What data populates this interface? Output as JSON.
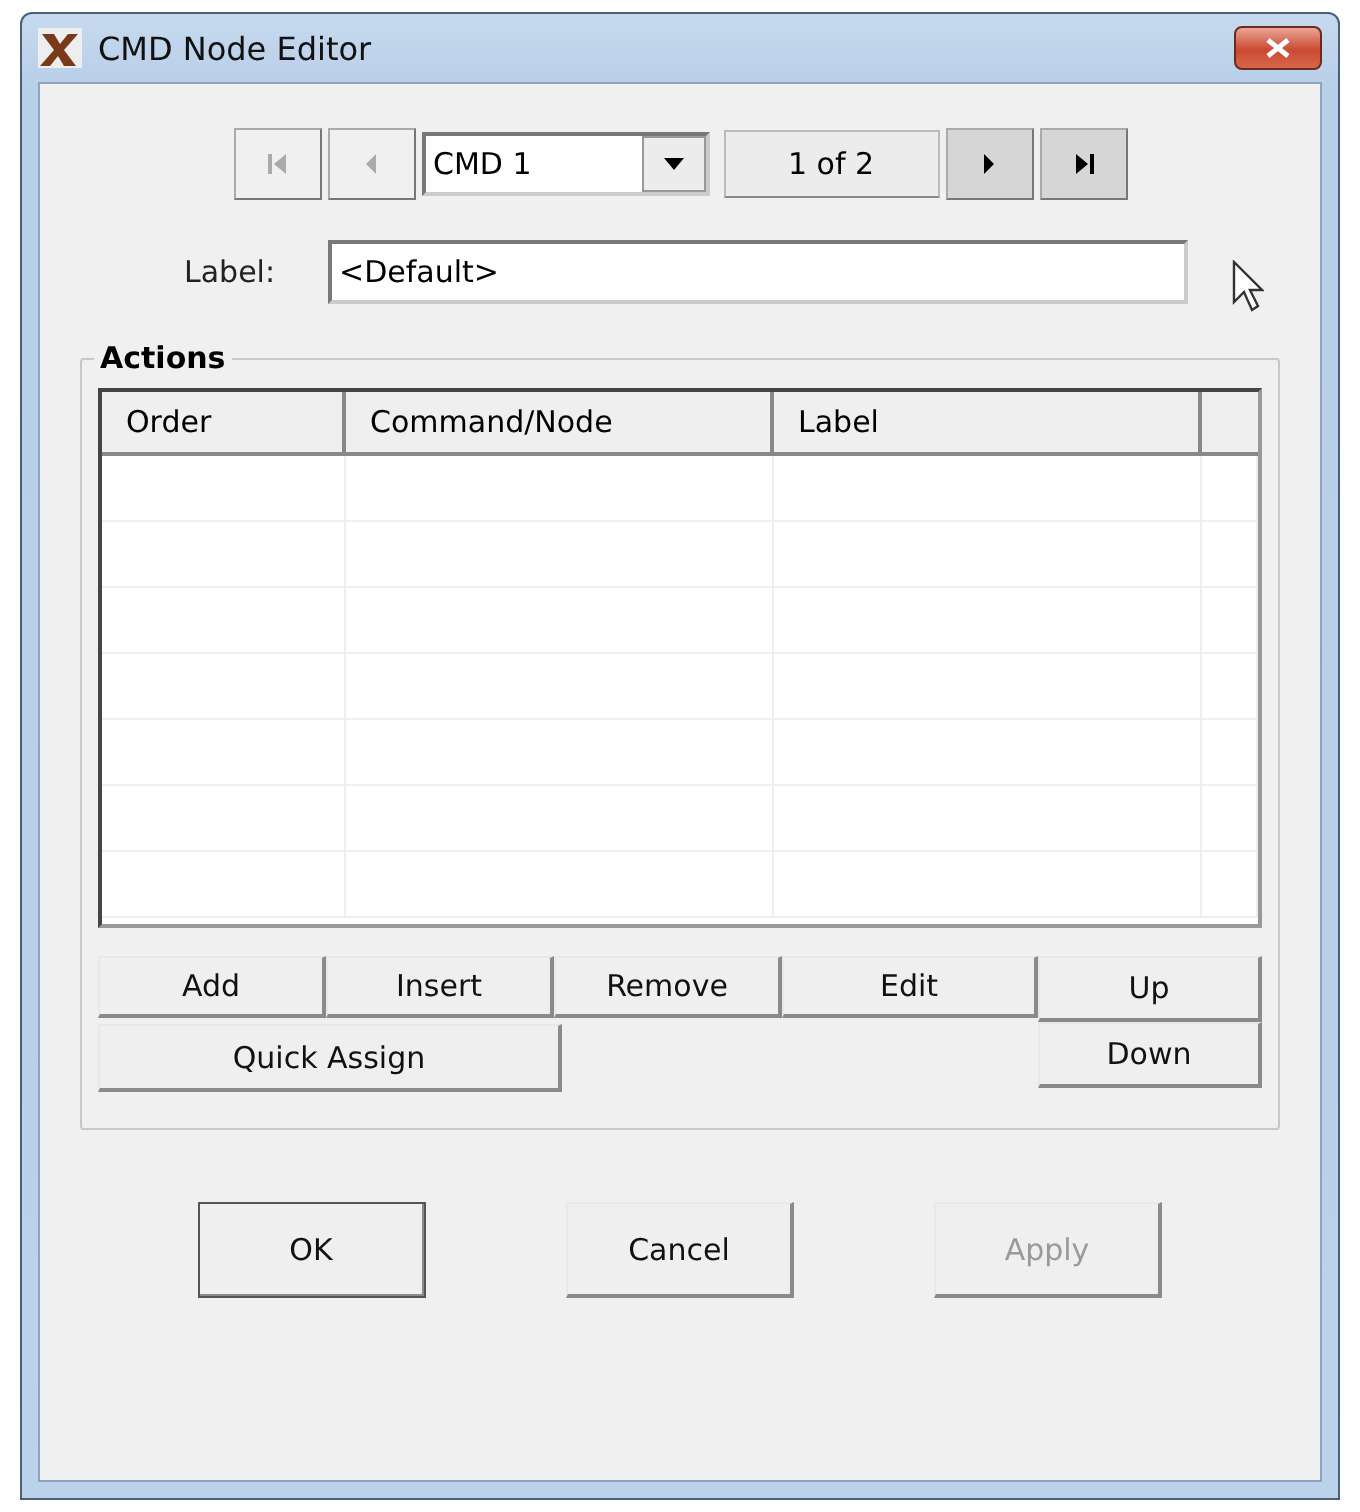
{
  "window": {
    "title": "CMD Node Editor"
  },
  "navigator": {
    "buttons": [
      {
        "kind": "first",
        "disabled": true
      },
      {
        "kind": "previous",
        "disabled": true
      },
      {
        "kind": "next",
        "disabled": false
      },
      {
        "kind": "last",
        "disabled": false
      }
    ],
    "selector": {
      "value": "CMD 1"
    },
    "position": "1 of 2"
  },
  "label_field": {
    "label": "Label:",
    "value": "<Default>"
  },
  "actions": {
    "title": "Actions",
    "table": {
      "columns": [
        "Order",
        "Command/Node",
        "Label"
      ]
    },
    "buttons": [
      {
        "label": "Add",
        "disabled": false
      },
      {
        "label": "Insert",
        "disabled": false
      },
      {
        "label": "Remove",
        "disabled": false
      },
      {
        "label": "Edit",
        "disabled": false
      }
    ],
    "quick_assign": {
      "label": "Quick Assign",
      "disabled": false
    },
    "move_buttons": [
      {
        "label": "Up",
        "disabled": false
      },
      {
        "label": "Down",
        "disabled": false
      }
    ]
  },
  "footer_buttons": [
    {
      "label": "OK",
      "default": true,
      "disabled": false
    },
    {
      "label": "Cancel",
      "default": false,
      "disabled": false
    },
    {
      "label": "Apply",
      "default": false,
      "disabled": true
    }
  ]
}
